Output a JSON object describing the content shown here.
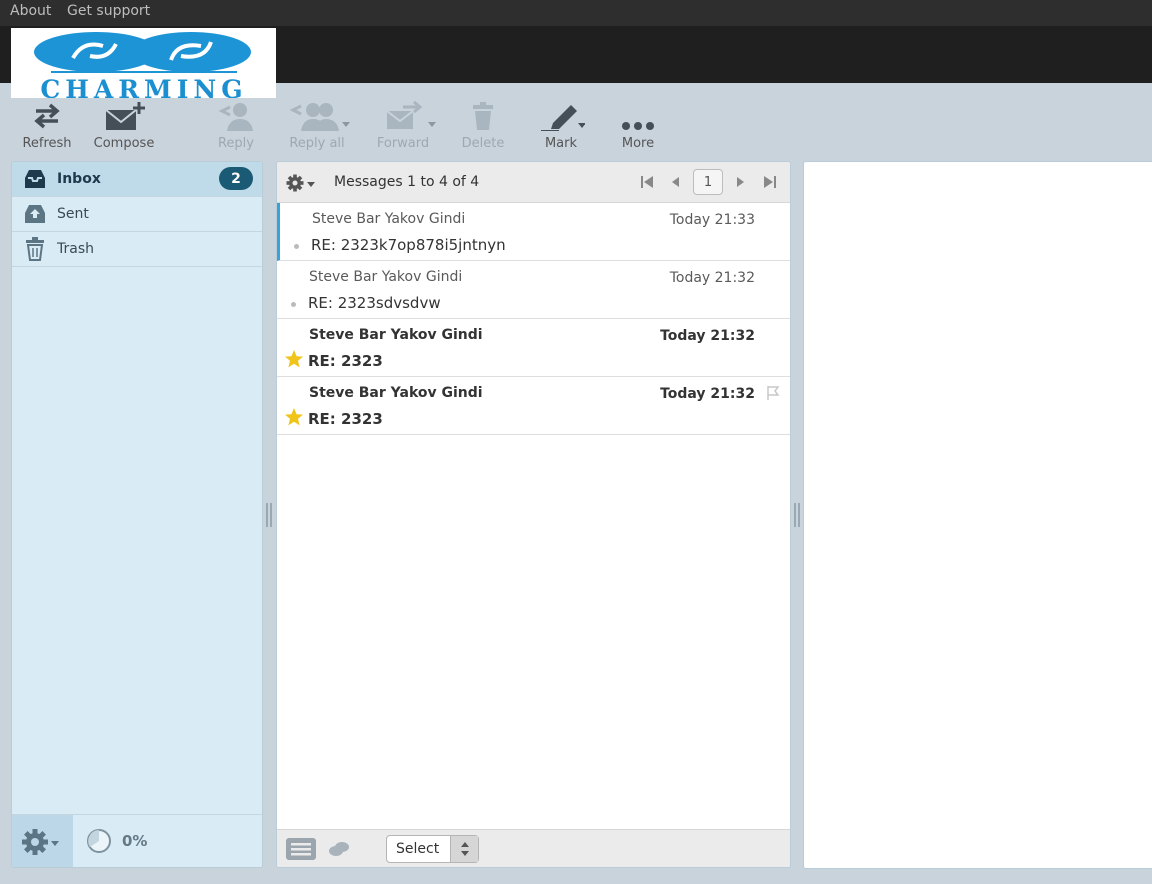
{
  "topbar": {
    "about": "About",
    "support": "Get support"
  },
  "logo": {
    "text": "CHARMING"
  },
  "toolbar": {
    "refresh": "Refresh",
    "compose": "Compose",
    "reply": "Reply",
    "reply_all": "Reply all",
    "forward": "Forward",
    "delete": "Delete",
    "mark": "Mark",
    "more": "More"
  },
  "folders": [
    {
      "name": "Inbox",
      "icon": "inbox-icon",
      "unread": "2",
      "selected": true
    },
    {
      "name": "Sent",
      "icon": "sent-icon"
    },
    {
      "name": "Trash",
      "icon": "trash-icon"
    }
  ],
  "quota": {
    "value": "0%"
  },
  "messagelist": {
    "count_text": "Messages 1 to 4 of 4",
    "page": "1",
    "messages": [
      {
        "from": "Steve Bar Yakov Gindi",
        "date": "Today 21:33",
        "subject": "RE: 2323k7op878i5jntnyn",
        "unread": false,
        "flagged": false
      },
      {
        "from": "Steve Bar Yakov Gindi",
        "date": "Today 21:32",
        "subject": "RE: 2323sdvsdvw",
        "unread": false,
        "flagged": false
      },
      {
        "from": "Steve Bar Yakov Gindi",
        "date": "Today 21:32",
        "subject": "RE: 2323",
        "unread": true,
        "flagged": true
      },
      {
        "from": "Steve Bar Yakov Gindi",
        "date": "Today 21:32",
        "subject": "RE: 2323",
        "unread": true,
        "flagged": true
      }
    ],
    "select_label": "Select"
  },
  "colors": {
    "accent": "#37a4d6",
    "badge": "#1b5a75",
    "star": "#f0c419",
    "panel": "#d9ebf4"
  }
}
